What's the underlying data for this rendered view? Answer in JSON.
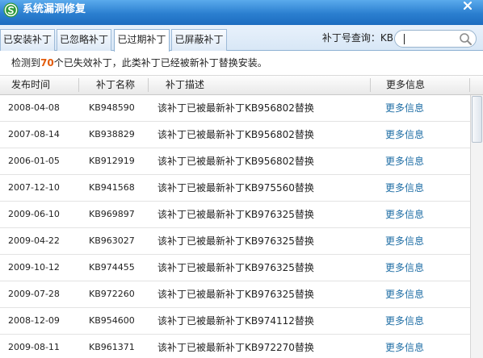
{
  "window": {
    "title": "系统漏洞修复"
  },
  "icons": {
    "app": "shield-s-icon",
    "close": "close-icon",
    "search": "search-icon"
  },
  "tabs": [
    {
      "label": "已安装补丁",
      "selected": false
    },
    {
      "label": "已忽略补丁",
      "selected": false
    },
    {
      "label": "已过期补丁",
      "selected": true
    },
    {
      "label": "已屏蔽补丁",
      "selected": false
    }
  ],
  "search": {
    "label": "补丁号查询：KB",
    "value": ""
  },
  "notice": {
    "prefix": "检测到",
    "count": "70",
    "suffix": "个已失效补丁，此类补丁已经被新补丁替换安装。"
  },
  "table": {
    "headers": {
      "date": "发布时间",
      "name": "补丁名称",
      "desc": "补丁描述",
      "more": "更多信息"
    },
    "rows": [
      {
        "date": "2008-04-08",
        "kb": "KB948590",
        "desc": "该补丁已被最新补丁KB956802替换",
        "more": "更多信息"
      },
      {
        "date": "2007-08-14",
        "kb": "KB938829",
        "desc": "该补丁已被最新补丁KB956802替换",
        "more": "更多信息"
      },
      {
        "date": "2006-01-05",
        "kb": "KB912919",
        "desc": "该补丁已被最新补丁KB956802替换",
        "more": "更多信息"
      },
      {
        "date": "2007-12-10",
        "kb": "KB941568",
        "desc": "该补丁已被最新补丁KB975560替换",
        "more": "更多信息"
      },
      {
        "date": "2009-06-10",
        "kb": "KB969897",
        "desc": "该补丁已被最新补丁KB976325替换",
        "more": "更多信息"
      },
      {
        "date": "2009-04-22",
        "kb": "KB963027",
        "desc": "该补丁已被最新补丁KB976325替换",
        "more": "更多信息"
      },
      {
        "date": "2009-10-12",
        "kb": "KB974455",
        "desc": "该补丁已被最新补丁KB976325替换",
        "more": "更多信息"
      },
      {
        "date": "2009-07-28",
        "kb": "KB972260",
        "desc": "该补丁已被最新补丁KB976325替换",
        "more": "更多信息"
      },
      {
        "date": "2008-12-09",
        "kb": "KB954600",
        "desc": "该补丁已被最新补丁KB974112替换",
        "more": "更多信息"
      },
      {
        "date": "2009-08-11",
        "kb": "KB961371",
        "desc": "该补丁已被最新补丁KB972270替换",
        "more": "更多信息"
      }
    ]
  },
  "scrollbar": {
    "position": 0
  },
  "colors": {
    "title_bar": "#2b7fd0",
    "link": "#1f6ea5",
    "highlight": "#e25b0a",
    "tab_strip": "#d8e7f6"
  }
}
